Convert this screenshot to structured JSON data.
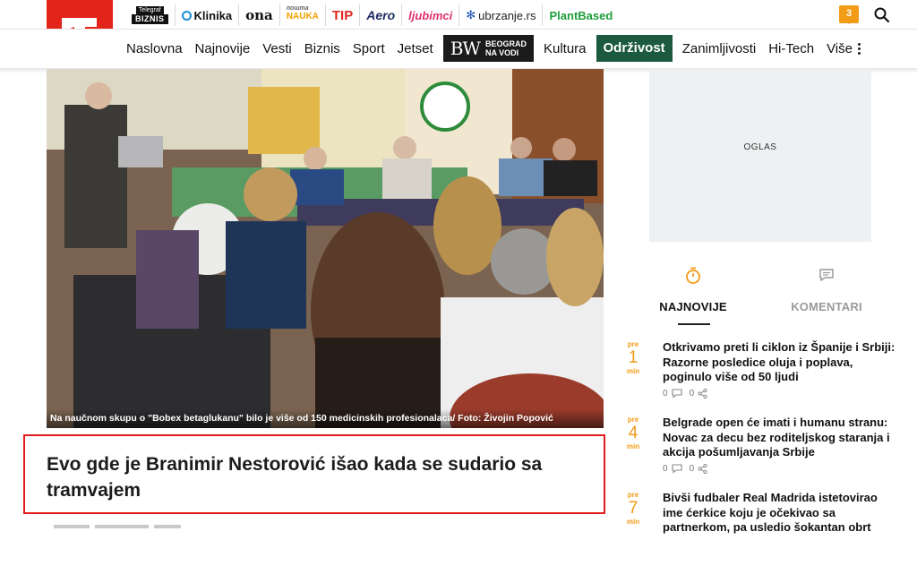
{
  "partners": [
    {
      "id": "biznis",
      "top": "Telegraf",
      "label": "BIZNIS"
    },
    {
      "id": "klinika",
      "label": "Klinika"
    },
    {
      "id": "ona",
      "label": "ona"
    },
    {
      "id": "nauka",
      "top": "пошта",
      "label": "NAUKA"
    },
    {
      "id": "tip",
      "label": "TIP"
    },
    {
      "id": "aero",
      "label": "Aero"
    },
    {
      "id": "ljubimci",
      "label": "ljubimci"
    },
    {
      "id": "ubrzanje",
      "label": "ubrzanje.rs"
    },
    {
      "id": "plantbased",
      "label": "PlantBased"
    }
  ],
  "notifications": {
    "count": "3"
  },
  "nav": {
    "items": [
      "Naslovna",
      "Najnovije",
      "Vesti",
      "Biznis",
      "Sport",
      "Jetset"
    ],
    "bw": {
      "logo": "BW",
      "line1": "BEOGRAD",
      "line2": "NA VODI"
    },
    "kultura": "Kultura",
    "odrzivost": "Održivost",
    "items2": [
      "Zanimljivosti",
      "Hi-Tech"
    ],
    "more": "Više"
  },
  "hero": {
    "caption": "Na naučnom skupu o \"Bobex betaglukanu\" bilo je više od 150 medicinskih profesionalaca/ Foto: Živojin Popović"
  },
  "article": {
    "headline": "Evo gde je Branimir Nestorović išao kada se sudario sa tramvajem"
  },
  "ad": {
    "label": "OGLAS"
  },
  "tabs": [
    {
      "label": "NAJNOVIJE",
      "icon": "stopwatch-icon",
      "active": true
    },
    {
      "label": "KOMENTARI",
      "icon": "comment-icon",
      "active": false
    }
  ],
  "news": [
    {
      "pre": "pre",
      "num": "1",
      "unit": "min",
      "title": "Otkrivamo preti li ciklon iz Španije i Srbiji: Razorne posledice oluja i poplava, poginulo više od 50 ljudi",
      "comments": "0",
      "shares": "0"
    },
    {
      "pre": "pre",
      "num": "4",
      "unit": "min",
      "title": "Belgrade open će imati i humanu stranu: Novac za decu bez roditeljskog staranja i akcija pošumljavanja Srbije",
      "comments": "0",
      "shares": "0"
    },
    {
      "pre": "pre",
      "num": "7",
      "unit": "min",
      "title": "Bivši fudbaler Real Madrida istetovirao ime ćerkice koju je očekivao sa partnerkom, pa usledio šokantan obrt",
      "comments": "",
      "shares": ""
    }
  ],
  "colors": {
    "brand_red": "#e3241b",
    "accent_orange": "#f29b16",
    "odrzivost_green": "#1b5a3e",
    "highlight_border": "#e21c1c"
  }
}
